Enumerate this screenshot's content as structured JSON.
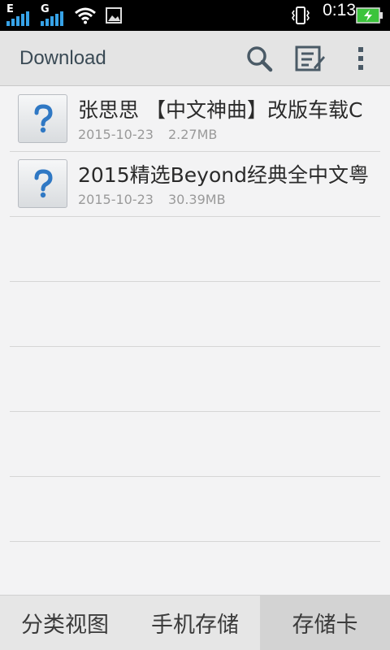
{
  "status_bar": {
    "network_1": "E",
    "network_2": "G",
    "time": "0:13",
    "icons": [
      "signal-icon",
      "signal-icon",
      "wifi-icon",
      "image-notification-icon",
      "vibrate-icon",
      "battery-charging-icon"
    ],
    "colors": {
      "background": "#000000",
      "battery": "#3cc43c"
    }
  },
  "header": {
    "title": "Download",
    "icons": [
      "search-icon",
      "edit-list-icon",
      "overflow-menu-icon"
    ]
  },
  "files": [
    {
      "name": "张思思 【中文神曲】改版车载C",
      "date": "2015-10-23",
      "size": "2.27MB",
      "icon": "unknown-file-icon"
    },
    {
      "name": "2015精选Beyond经典全中文粤",
      "date": "2015-10-23",
      "size": "30.39MB",
      "icon": "unknown-file-icon"
    }
  ],
  "tabs": [
    {
      "label": "分类视图",
      "active": false
    },
    {
      "label": "手机存储",
      "active": false
    },
    {
      "label": "存储卡",
      "active": true
    }
  ]
}
